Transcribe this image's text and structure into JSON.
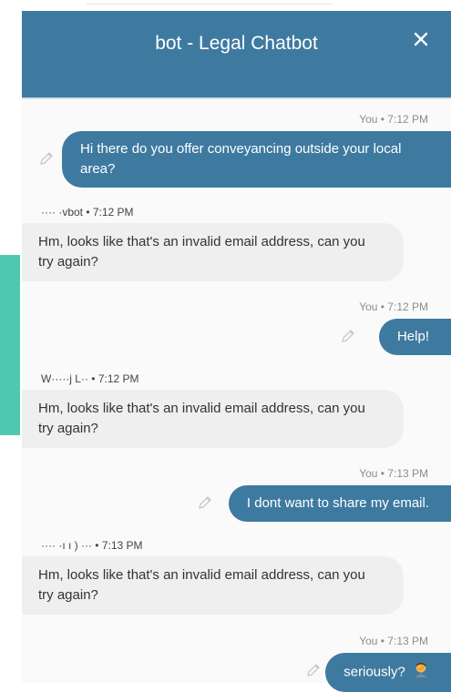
{
  "header": {
    "title": "bot - Legal Chatbot",
    "close_label": "✕"
  },
  "colors": {
    "header": "#3e7aa0",
    "user_bubble": "#3e7aa0",
    "bot_bubble": "#efefef",
    "accent_strip": "#4ec9b0"
  },
  "messages": [
    {
      "sender": "user",
      "meta": "You • 7:12 PM",
      "text": "Hi there do you offer conveyancing outside your local area?"
    },
    {
      "sender": "bot",
      "meta": "···· ·vbot • 7:12 PM",
      "text": "Hm, looks like that's an invalid email address, can you try again?"
    },
    {
      "sender": "user",
      "meta": "You • 7:12 PM",
      "text": "Help!"
    },
    {
      "sender": "bot",
      "meta": "W·····j L·· • 7:12 PM",
      "text": "Hm, looks like that's an invalid email address, can you try again?"
    },
    {
      "sender": "user",
      "meta": "You • 7:13 PM",
      "text": "I dont want to share my email."
    },
    {
      "sender": "bot",
      "meta": "···· ·ı ı ) ··· • 7:13 PM",
      "text": "Hm, looks like that's an invalid email address, can you try again?"
    },
    {
      "sender": "user",
      "meta": "You • 7:13 PM",
      "text": "seriously?",
      "emoji": "person-facepalming-emoji"
    }
  ]
}
